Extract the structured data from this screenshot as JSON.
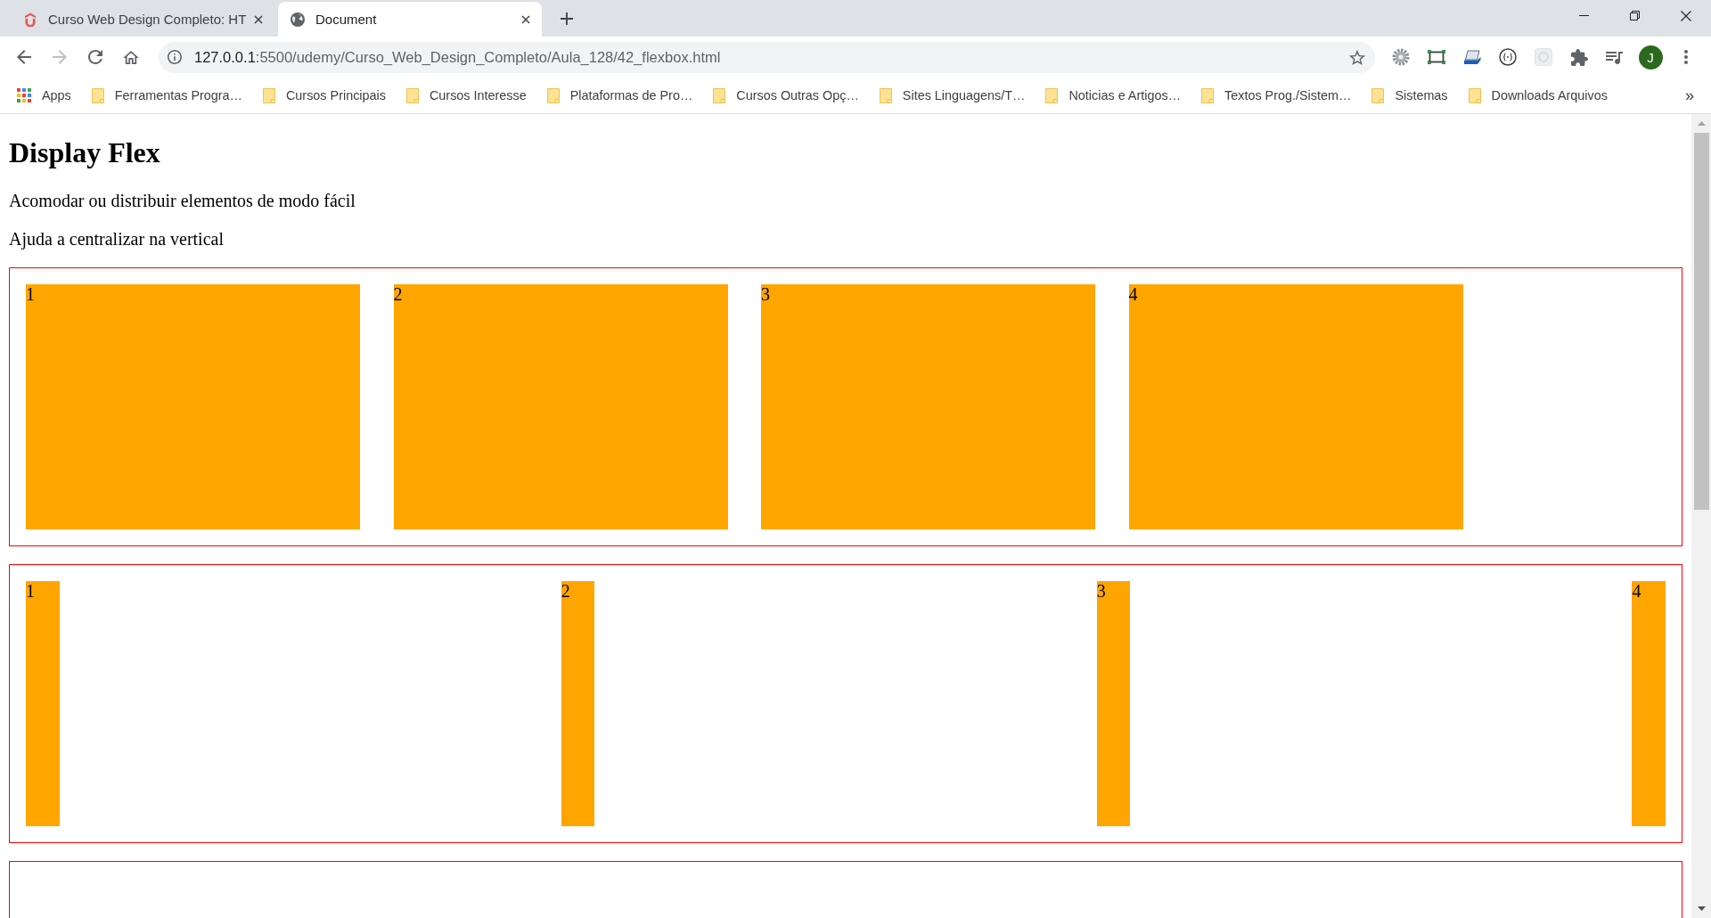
{
  "browser": {
    "tabs": [
      {
        "title": "Curso Web Design Completo: HT",
        "kind": "logo",
        "selected": false
      },
      {
        "title": "Document",
        "kind": "globe",
        "selected": true
      }
    ],
    "nav_buttons": [
      {
        "kind": "back",
        "disabled": false
      },
      {
        "kind": "forward",
        "disabled": true
      },
      {
        "kind": "reload",
        "disabled": false
      },
      {
        "kind": "home",
        "disabled": false
      }
    ],
    "address_bar": {
      "host": "127.0.0.1",
      "path": ":5500/udemy/Curso_Web_Design_Completo/Aula_128/42_flexbox.html"
    },
    "profile": {
      "initial": "J"
    },
    "bookmarks": [
      {
        "label": "Apps",
        "kind": "apps"
      },
      {
        "label": "Ferramentas Progra…",
        "kind": "folder"
      },
      {
        "label": "Cursos Principais",
        "kind": "folder"
      },
      {
        "label": "Cursos Interesse",
        "kind": "folder"
      },
      {
        "label": "Plataformas de Pro…",
        "kind": "folder"
      },
      {
        "label": "Cursos Outras Opç…",
        "kind": "folder"
      },
      {
        "label": "Sites Linguagens/T…",
        "kind": "folder"
      },
      {
        "label": "Noticias e Artigos…",
        "kind": "folder"
      },
      {
        "label": "Textos Prog./Sistem…",
        "kind": "folder"
      },
      {
        "label": "Sistemas",
        "kind": "folder"
      },
      {
        "label": "Downloads Arquivos",
        "kind": "folder"
      }
    ],
    "bookmarks_overflow": "»"
  },
  "page": {
    "heading": "Display Flex",
    "paragraphs": [
      "Acomodar ou distribuir elementos de modo fácil",
      "Ajuda a centralizar na vertical"
    ],
    "containers": [
      {
        "kind": "fixed",
        "items": [
          "1",
          "2",
          "3",
          "4"
        ]
      },
      {
        "kind": "space-between",
        "items": [
          "1",
          "2",
          "3",
          "4"
        ]
      },
      {
        "kind": "clipped"
      }
    ]
  }
}
